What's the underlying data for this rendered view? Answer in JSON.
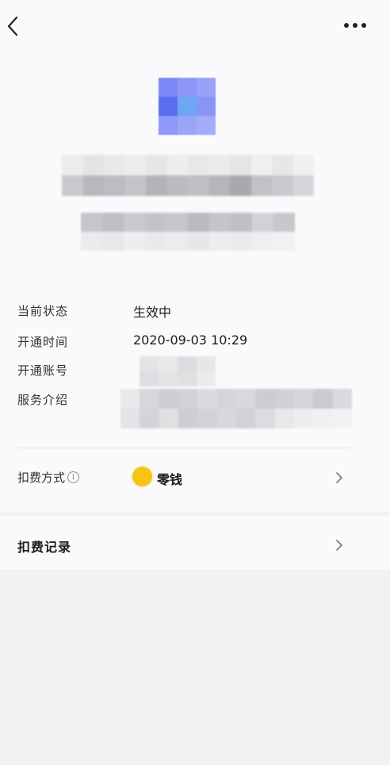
{
  "nav": {
    "back_icon": "chevron-left-icon",
    "more_icon": "more-horizontal-icon"
  },
  "service": {
    "logo_colors": [
      "#7d88f6",
      "#8b96f7",
      "#97a2f8",
      "#5c6cf0",
      "#6fa6f4",
      "#8994f6",
      "#8d98f7",
      "#9aa4f8",
      "#a2acf9"
    ],
    "name_redacted": true,
    "subtitle_redacted": true
  },
  "details": {
    "status_label": "当前状态",
    "status_value": "生效中",
    "open_time_label": "开通时间",
    "open_time_value": "2020-09-03 10:29",
    "account_label": "开通账号",
    "description_label": "服务介绍"
  },
  "payment": {
    "label": "扣费方式",
    "info_icon": "info-circle-icon",
    "method_icon": "coin-icon",
    "method_color": "#f6c415",
    "method_value": "零钱",
    "chevron_icon": "chevron-right-icon"
  },
  "records": {
    "label": "扣费记录",
    "chevron_icon": "chevron-right-icon"
  }
}
